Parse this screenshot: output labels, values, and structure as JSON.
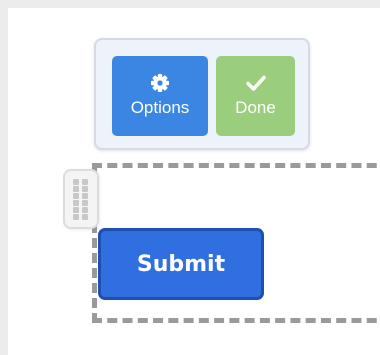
{
  "toolbar": {
    "options": {
      "label": "Options",
      "icon": "gear-icon",
      "color": "#3b86e3"
    },
    "done": {
      "label": "Done",
      "icon": "checkmark-icon",
      "color": "#9bce7c"
    }
  },
  "form": {
    "submit_label": "Submit",
    "submit_color": "#2f6fdf"
  },
  "drag_handle": {
    "icon": "grip-dots-icon"
  }
}
